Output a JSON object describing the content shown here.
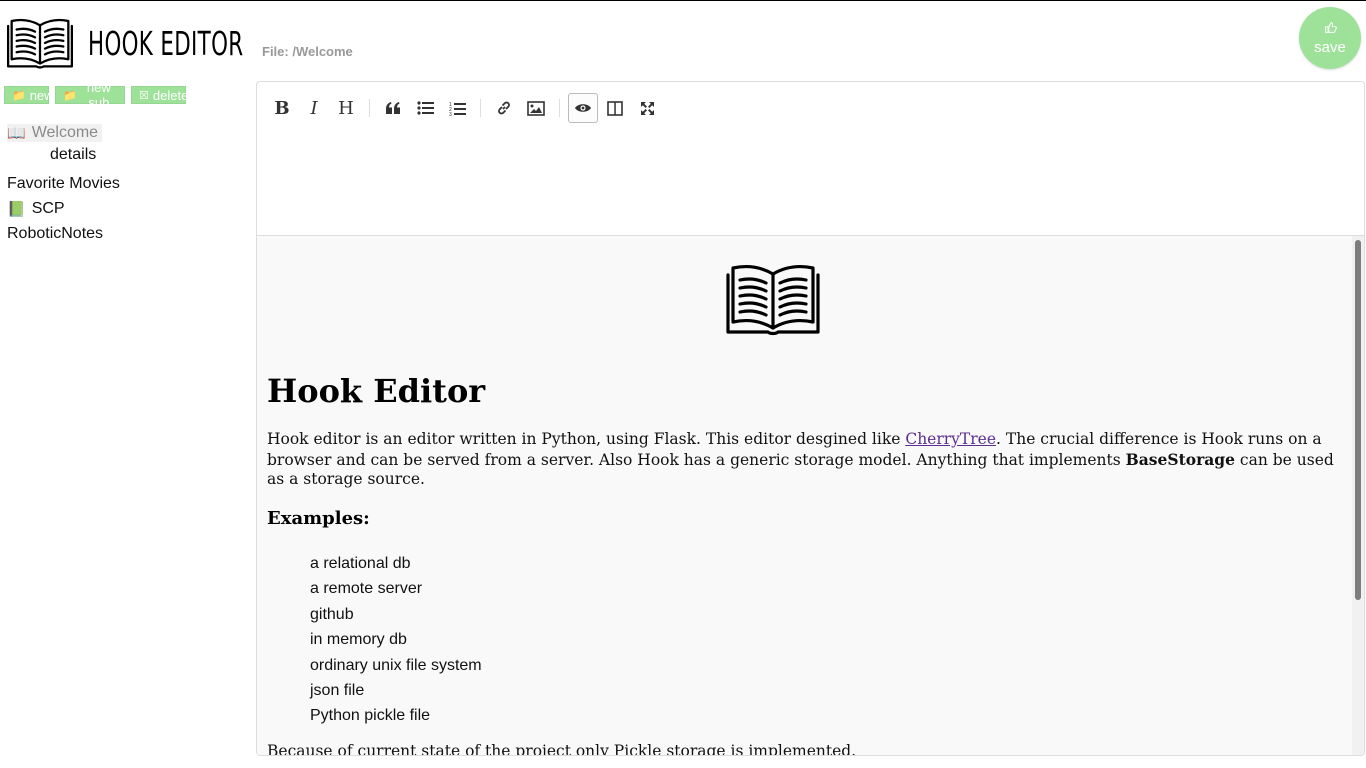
{
  "app": {
    "title": "HOOK EDITOR"
  },
  "sidebar": {
    "buttons": {
      "new": "new",
      "new_sub": "new sub",
      "delete": "delete"
    },
    "tree": [
      {
        "label": "Welcome",
        "emoji": "📖",
        "selected": true
      },
      {
        "label": "details",
        "child": true
      },
      {
        "label": "Favorite Movies"
      },
      {
        "label": "SCP",
        "emoji": "📗"
      },
      {
        "label": "RoboticNotes"
      }
    ]
  },
  "header": {
    "file_path": "File: /Welcome",
    "save_label": "save"
  },
  "toolbar": {
    "items": [
      "bold",
      "italic",
      "heading",
      "quote",
      "unordered-list",
      "ordered-list",
      "link",
      "image",
      "preview",
      "side-by-side",
      "fullscreen"
    ],
    "active": "preview"
  },
  "preview": {
    "title": "Hook Editor",
    "intro_before_link": "Hook editor is an editor written in Python, using Flask. This editor desgined like ",
    "link_text": "CherryTree",
    "intro_after_link": ". The crucial difference is Hook runs on a browser and can be served from a server. Also Hook has a generic storage model. Anything that implements ",
    "intro_bold": "BaseStorage",
    "intro_end": " can be used as a storage source.",
    "examples_heading": "Examples:",
    "examples": [
      "a relational db",
      "a remote server",
      "github",
      "in memory db",
      "ordinary unix file system",
      "json file",
      "Python pickle file"
    ],
    "outro": "Because of current state of the project only Pickle storage is implemented."
  }
}
